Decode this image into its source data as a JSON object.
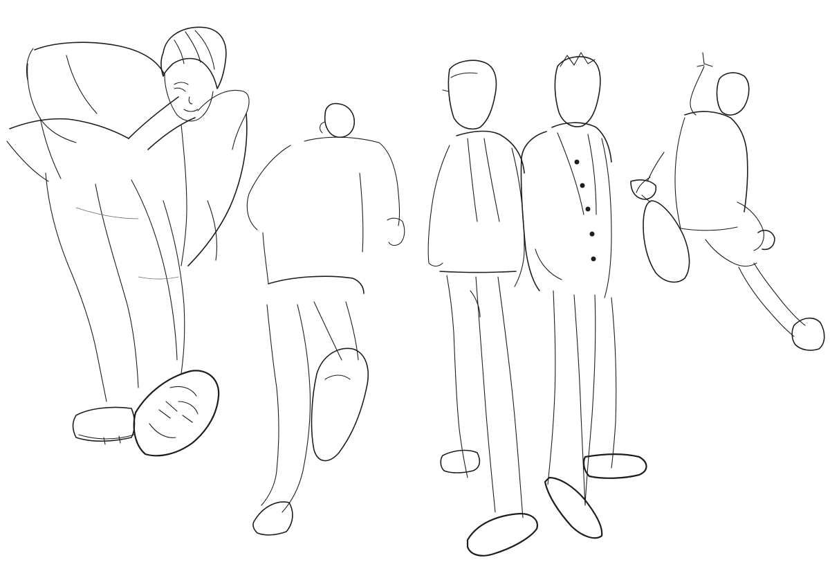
{
  "image": {
    "background_color": "#ffffff",
    "ink_color": "#1c1c1c",
    "figures": [
      "figure-crouching-kick",
      "figure-running-away",
      "figure-standing-hands-in-pockets",
      "figure-standing-buttoned-jacket",
      "figure-tennis-jump"
    ]
  }
}
